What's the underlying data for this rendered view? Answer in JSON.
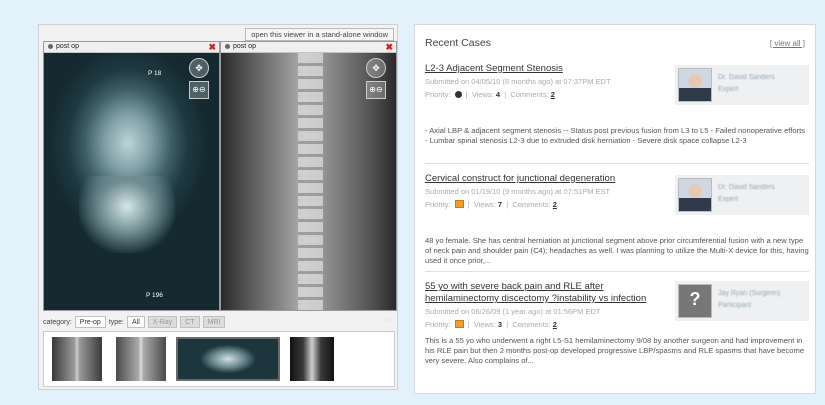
{
  "viewer": {
    "standalone_label": "open this viewer in a stand-alone window",
    "panes": [
      {
        "title": "post op",
        "labels": [
          "P 18",
          "P 196"
        ]
      },
      {
        "title": "post op",
        "labels": []
      }
    ],
    "close_glyph": "✖",
    "filters": {
      "category_label": "category:",
      "category_value": "Pre-op",
      "type_label": "type:",
      "types": [
        {
          "label": "All",
          "active": true
        },
        {
          "label": "X-Ray",
          "active": false
        },
        {
          "label": "CT",
          "active": false
        },
        {
          "label": "MRI",
          "active": false
        }
      ]
    }
  },
  "cases_panel": {
    "title": "Recent Cases",
    "view_all": "[ view all ]",
    "priority_label": "Priority:",
    "views_label": "Views:",
    "comments_label": "Comments:",
    "items": [
      {
        "title": "L2-3 Adjacent Segment Stenosis",
        "submitted": "Submitted on 04/05/10 (6 months ago) at 07:37PM EDT",
        "priority_icon": "dark",
        "views": "4",
        "comments": "2",
        "body": "- Axial LBP & adjacent segment stenosis -- Status post previous fusion from L3 to L5 - Failed nonoperative efforts - Lumbar spinal stenosis L2-3 due to extruded disk herniation - Severe disk space collapse L2-3",
        "expert": {
          "name": "Dr. David Sanders",
          "role": "Expert",
          "photo": "person-photo"
        }
      },
      {
        "title": "Cervical construct for junctional degeneration",
        "submitted": "Submitted on 01/19/10 (9 months ago) at 07:51PM EST",
        "priority_icon": "orange",
        "views": "7",
        "comments": "2",
        "body": "48 yo female. She has central herniation at junctional segment above prior circumferential fusion with a new type of neck pain and shoulder pain (C4); headaches as well. I was planning to utilize the Multi-X device for this, having used it once prior,...",
        "expert": {
          "name": "Dr. David Sanders",
          "role": "Expert",
          "photo": "person-photo"
        }
      },
      {
        "title": "55 yo with severe back pain and RLE after hemilaminectomy discectomy ?instability vs infection",
        "submitted": "Submitted on 06/26/09 (1 year ago) at 01:56PM EDT",
        "priority_icon": "orange",
        "views": "3",
        "comments": "2",
        "body": "This is a 55 yo who underwent a right L5-S1 hemilaminectomy 9/08 by another surgeon and had improvement in his RLE pain but then 2 months post-op developed progressive LBP/spasms and RLE spasms that have become very severe. Also complains of...",
        "expert": {
          "name": "Jay Ryan (Surgeon)",
          "role": "Participant",
          "photo": "placeholder"
        }
      }
    ]
  }
}
